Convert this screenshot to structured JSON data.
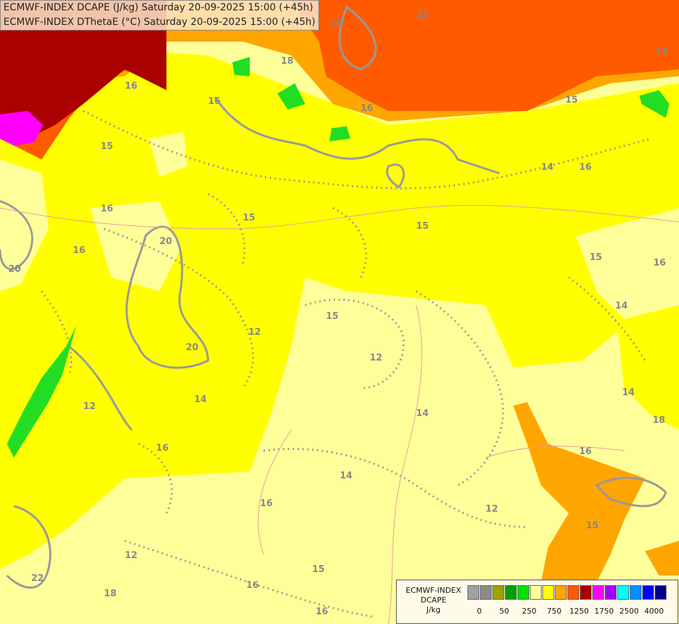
{
  "titles": {
    "line1": "ECMWF-INDEX DCAPE (J/kg) Saturday 20-09-2025 15:00 (+45h)",
    "line2": "ECMWF-INDEX DThetaE (°C) Saturday 20-09-2025 15:00 (+45h)"
  },
  "colors": {
    "pale_yellow": "#ffff99",
    "yellow": "#ffff00",
    "orange_light": "#ffa500",
    "orange": "#ff8c1a",
    "red_orange": "#ff5a00",
    "dark_red": "#aa0000",
    "magenta": "#ff00ff",
    "green": "#22dd22",
    "contour": "#999999"
  },
  "contour_labels": [
    "18",
    "16",
    "16",
    "22",
    "16",
    "14",
    "15",
    "16",
    "15",
    "16",
    "20",
    "15",
    "16",
    "20",
    "15",
    "15",
    "15",
    "12",
    "12",
    "20",
    "14",
    "16",
    "14",
    "14",
    "16",
    "12",
    "15",
    "14",
    "16",
    "14",
    "16",
    "18",
    "12",
    "12",
    "18",
    "15",
    "16",
    "16",
    "16",
    "22",
    "14"
  ],
  "legend": {
    "title_line1": "ECMWF-INDEX",
    "title_line2": "DCAPE",
    "title_line3": "J/kg",
    "swatches": [
      "#a0a0a0",
      "#8c8c8c",
      "#a0a000",
      "#00a000",
      "#00e000",
      "#ffff99",
      "#ffff00",
      "#ffa500",
      "#ff5a00",
      "#aa0000",
      "#ff00ff",
      "#a000ff",
      "#00ffff",
      "#0090ff",
      "#0000ff",
      "#00008b"
    ],
    "ticks": [
      "0",
      "50",
      "250",
      "750",
      "1250",
      "1750",
      "2500",
      "4000"
    ]
  }
}
